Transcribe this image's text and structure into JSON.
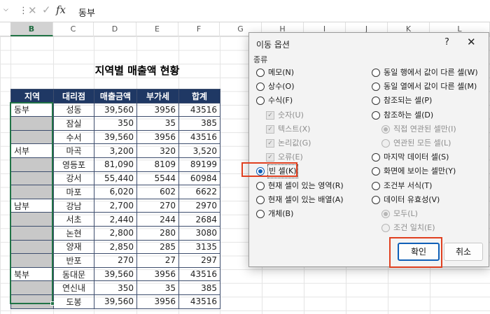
{
  "formula_bar": {
    "content": "동부"
  },
  "columns": [
    "B",
    "C",
    "D",
    "E",
    "F",
    "G",
    "H",
    "I",
    "J",
    "K",
    "L"
  ],
  "sheet_title": "지역별 매출액 현황",
  "table": {
    "headers": [
      "지역",
      "대리점",
      "매출금액",
      "부가세",
      "합계"
    ],
    "rows": [
      [
        "동부",
        "성동",
        "39,560",
        "3956",
        "43516"
      ],
      [
        "",
        "잠실",
        "350",
        "35",
        "385"
      ],
      [
        "",
        "수서",
        "39,560",
        "3956",
        "43516"
      ],
      [
        "서부",
        "마곡",
        "3,200",
        "320",
        "3,520"
      ],
      [
        "",
        "영등포",
        "81,090",
        "8109",
        "89199"
      ],
      [
        "",
        "강서",
        "55,440",
        "5544",
        "60984"
      ],
      [
        "",
        "마포",
        "6,020",
        "602",
        "6622"
      ],
      [
        "남부",
        "강남",
        "2,700",
        "270",
        "2970"
      ],
      [
        "",
        "서초",
        "2,440",
        "244",
        "2684"
      ],
      [
        "",
        "논현",
        "2,800",
        "280",
        "3080"
      ],
      [
        "",
        "양재",
        "2,850",
        "285",
        "3135"
      ],
      [
        "",
        "반포",
        "270",
        "27",
        "297"
      ],
      [
        "북부",
        "동대문",
        "39,560",
        "3956",
        "43516"
      ],
      [
        "",
        "연신내",
        "350",
        "35",
        "385"
      ],
      [
        "",
        "도봉",
        "39,560",
        "3956",
        "43516"
      ]
    ]
  },
  "dialog": {
    "title": "이동 옵션",
    "help": "?",
    "close": "✕",
    "group_label": "종류",
    "left_options": [
      {
        "label": "메모(N)",
        "type": "radio",
        "checked": false,
        "disabled": false
      },
      {
        "label": "상수(O)",
        "type": "radio",
        "checked": false,
        "disabled": false
      },
      {
        "label": "수식(F)",
        "type": "radio",
        "checked": false,
        "disabled": false
      },
      {
        "label": "숫자(U)",
        "type": "checkbox",
        "checked": true,
        "disabled": true
      },
      {
        "label": "텍스트(X)",
        "type": "checkbox",
        "checked": true,
        "disabled": true
      },
      {
        "label": "논리값(G)",
        "type": "checkbox",
        "checked": true,
        "disabled": true
      },
      {
        "label": "오류(E)",
        "type": "checkbox",
        "checked": true,
        "disabled": true
      },
      {
        "label": "빈 셀(K)",
        "type": "radio",
        "checked": true,
        "disabled": false
      },
      {
        "label": "현재 셀이 있는 영역(R)",
        "type": "radio",
        "checked": false,
        "disabled": false
      },
      {
        "label": "현재 셀이 있는 배열(A)",
        "type": "radio",
        "checked": false,
        "disabled": false
      },
      {
        "label": "개체(B)",
        "type": "radio",
        "checked": false,
        "disabled": false
      }
    ],
    "right_options": [
      {
        "label": "동일 행에서 값이 다른 셀(W)",
        "type": "radio",
        "checked": false,
        "disabled": false
      },
      {
        "label": "동일 열에서 값이 다른 셀(M)",
        "type": "radio",
        "checked": false,
        "disabled": false
      },
      {
        "label": "참조되는 셀(P)",
        "type": "radio",
        "checked": false,
        "disabled": false
      },
      {
        "label": "참조하는 셀(D)",
        "type": "radio",
        "checked": false,
        "disabled": false
      },
      {
        "label": "직접 연관된 셀만(I)",
        "type": "radio",
        "checked": true,
        "disabled": true
      },
      {
        "label": "연관된 모든 셀(L)",
        "type": "radio",
        "checked": false,
        "disabled": true
      },
      {
        "label": "마지막 데이터 셀(S)",
        "type": "radio",
        "checked": false,
        "disabled": false
      },
      {
        "label": "화면에 보이는 셀만(Y)",
        "type": "radio",
        "checked": false,
        "disabled": false
      },
      {
        "label": "조건부 서식(T)",
        "type": "radio",
        "checked": false,
        "disabled": false
      },
      {
        "label": "데이터 유효성(V)",
        "type": "radio",
        "checked": false,
        "disabled": false
      },
      {
        "label": "모두(L)",
        "type": "radio",
        "checked": true,
        "disabled": true
      },
      {
        "label": "조건 일치(E)",
        "type": "radio",
        "checked": false,
        "disabled": true
      }
    ],
    "ok_label": "확인",
    "cancel_label": "취소"
  },
  "colors": {
    "header_fill": "#1f3864",
    "selection": "#217346",
    "highlight": "#e04020",
    "accent": "#0f5fb7"
  }
}
